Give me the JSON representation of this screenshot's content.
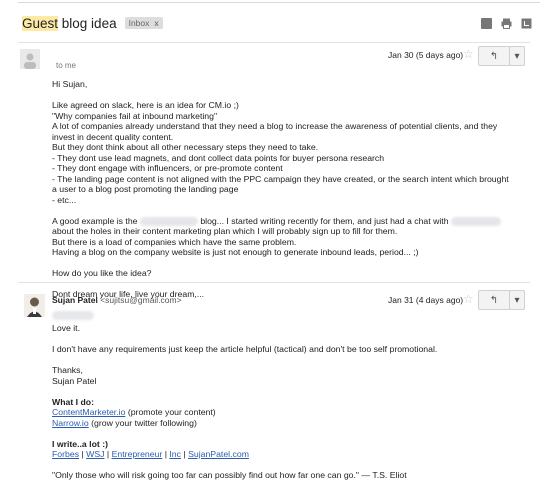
{
  "thread": {
    "subject_highlight": "Guest",
    "subject_rest": " blog idea",
    "label": "Inbox",
    "label_close": "x"
  },
  "message1": {
    "to": "to me",
    "date": "Jan 30 (5 days ago)",
    "greeting": "Hi Sujan,",
    "lines": [
      "Like agreed on slack, here is an idea for CM.io ;)",
      "\"Why companies fail at inbound marketing\"",
      "A lot of companies already understand that they need a blog to increase the awareness of potential clients, and they",
      "invest in decent quality content.",
      "But they dont think about all other necessary steps they need to take.",
      "- They dont use lead magnets, and dont collect data points for buyer persona research",
      "- They dont engage with influencers, or pre-promote content",
      "- The landing page content is not aligned with the PPC campaign they have created, or the search intent which brought",
      "a user to a blog post promoting the landing page",
      "- etc..."
    ],
    "example_a": "A good example is the ",
    "example_b": " blog... I started writing recently for them, and just had a chat with ",
    "example_lines": [
      "about the holes in their content marketing plan which I will probably sign up to fill for them.",
      "But there is a load of companies which have the same problem.",
      "Having a blog on the company website is just not enough to generate inbound leads, period... ;)"
    ],
    "question": "How do you like the idea?",
    "signoff": "Dont dream your life, live your dream,..."
  },
  "message2": {
    "sender_name": "Sujan Patel",
    "sender_email": "<sujitsu@gmail.com>",
    "date": "Jan 31 (4 days ago)",
    "love": "Love it.",
    "para": "I don't have any requirements just keep the article helpful (tactical) and don't be too self promotional.",
    "thanks": "Thanks,",
    "name": "Sujan Patel",
    "what_heading": "What I do:",
    "link1": "ContentMarketer.io",
    "link1_note": " (promote your content)",
    "link2": "Narrow.io",
    "link2_note": " (grow your twitter following)",
    "write_heading": "I write..a lot :)",
    "pubs": [
      "Forbes",
      "WSJ",
      "Entrepreneur",
      "Inc",
      "SujanPatel.com"
    ],
    "pub_sep": " | ",
    "quote": "\"Only those who will risk going too far can possibly find out how far one can go.\" — T.S. Eliot"
  },
  "icons": {
    "reply": "↰",
    "more": "▾",
    "star": "☆"
  }
}
